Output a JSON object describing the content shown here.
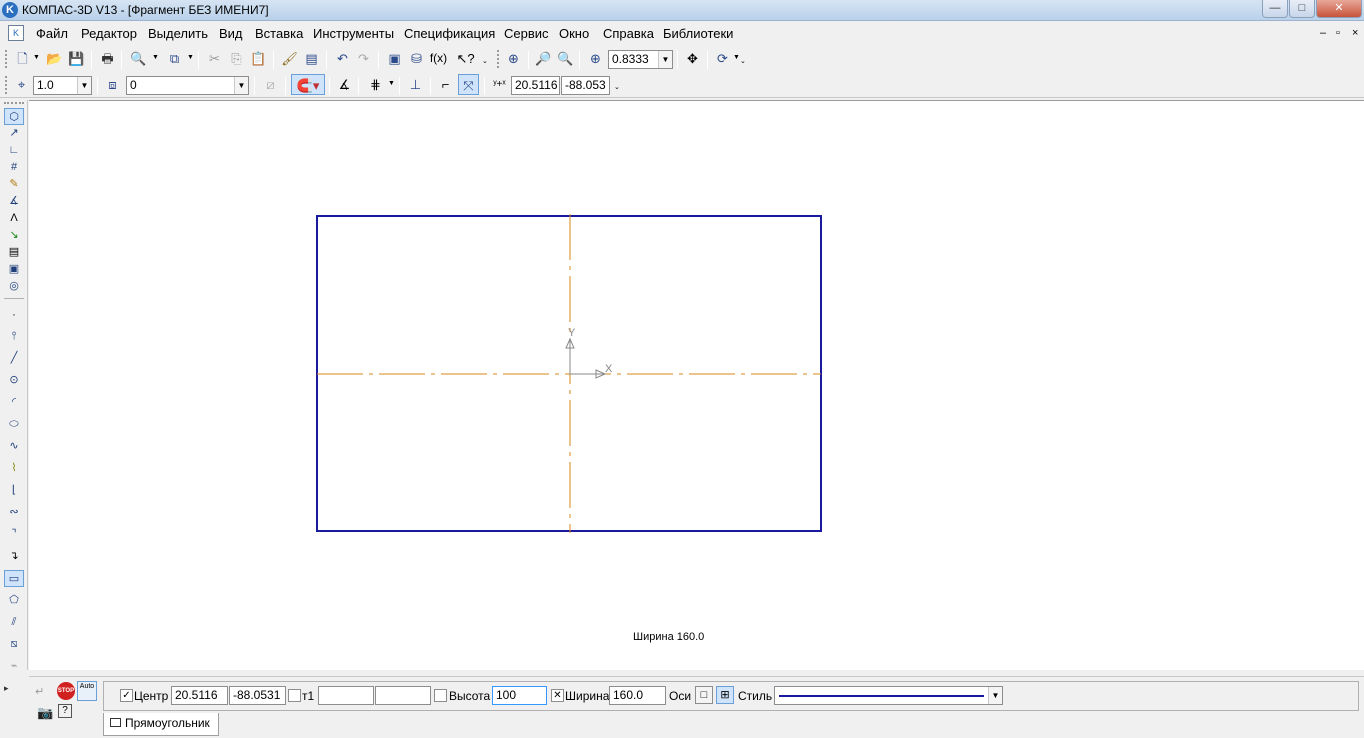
{
  "window": {
    "title": "КОМПАС-3D V13 - [Фрагмент БЕЗ ИМЕНИ7]",
    "app_icon": "K",
    "controls": {
      "minimize": "—",
      "maximize": "□",
      "close": "✕"
    }
  },
  "menu": {
    "items": [
      "Файл",
      "Редактор",
      "Выделить",
      "Вид",
      "Вставка",
      "Инструменты",
      "Спецификация",
      "Сервис",
      "Окно",
      "Справка",
      "Библиотеки"
    ],
    "mdi_controls": [
      "–",
      "▫",
      "×"
    ]
  },
  "toolbar_standard": {
    "zoom_value": "0.8333"
  },
  "toolbar_current_state": {
    "step": "1.0",
    "layer": "0",
    "coord_x": "20.5116",
    "coord_y": "-88.053"
  },
  "canvas": {
    "axis_x_label": "X",
    "axis_y_label": "Y",
    "hint_text": "Ширина 160.0",
    "colors": {
      "rectangle": "#1a1aa0",
      "axis_lines": "#d48a1a",
      "background": "#ffffff"
    }
  },
  "property_panel": {
    "center_label": "Центр",
    "center_checked": "✓",
    "center_x": "20.5116",
    "center_y": "-88.0531",
    "t1_label": "т1",
    "t1_x": "",
    "t1_y": "",
    "height_label": "Высота",
    "height_value": "100",
    "width_label": "Ширина",
    "width_checked": "✕",
    "width_value": "160.0",
    "axes_label": "Оси",
    "style_label": "Стиль",
    "tab_label": "Прямоугольник",
    "stop_label": "STOP",
    "auto_label": "Auto"
  }
}
